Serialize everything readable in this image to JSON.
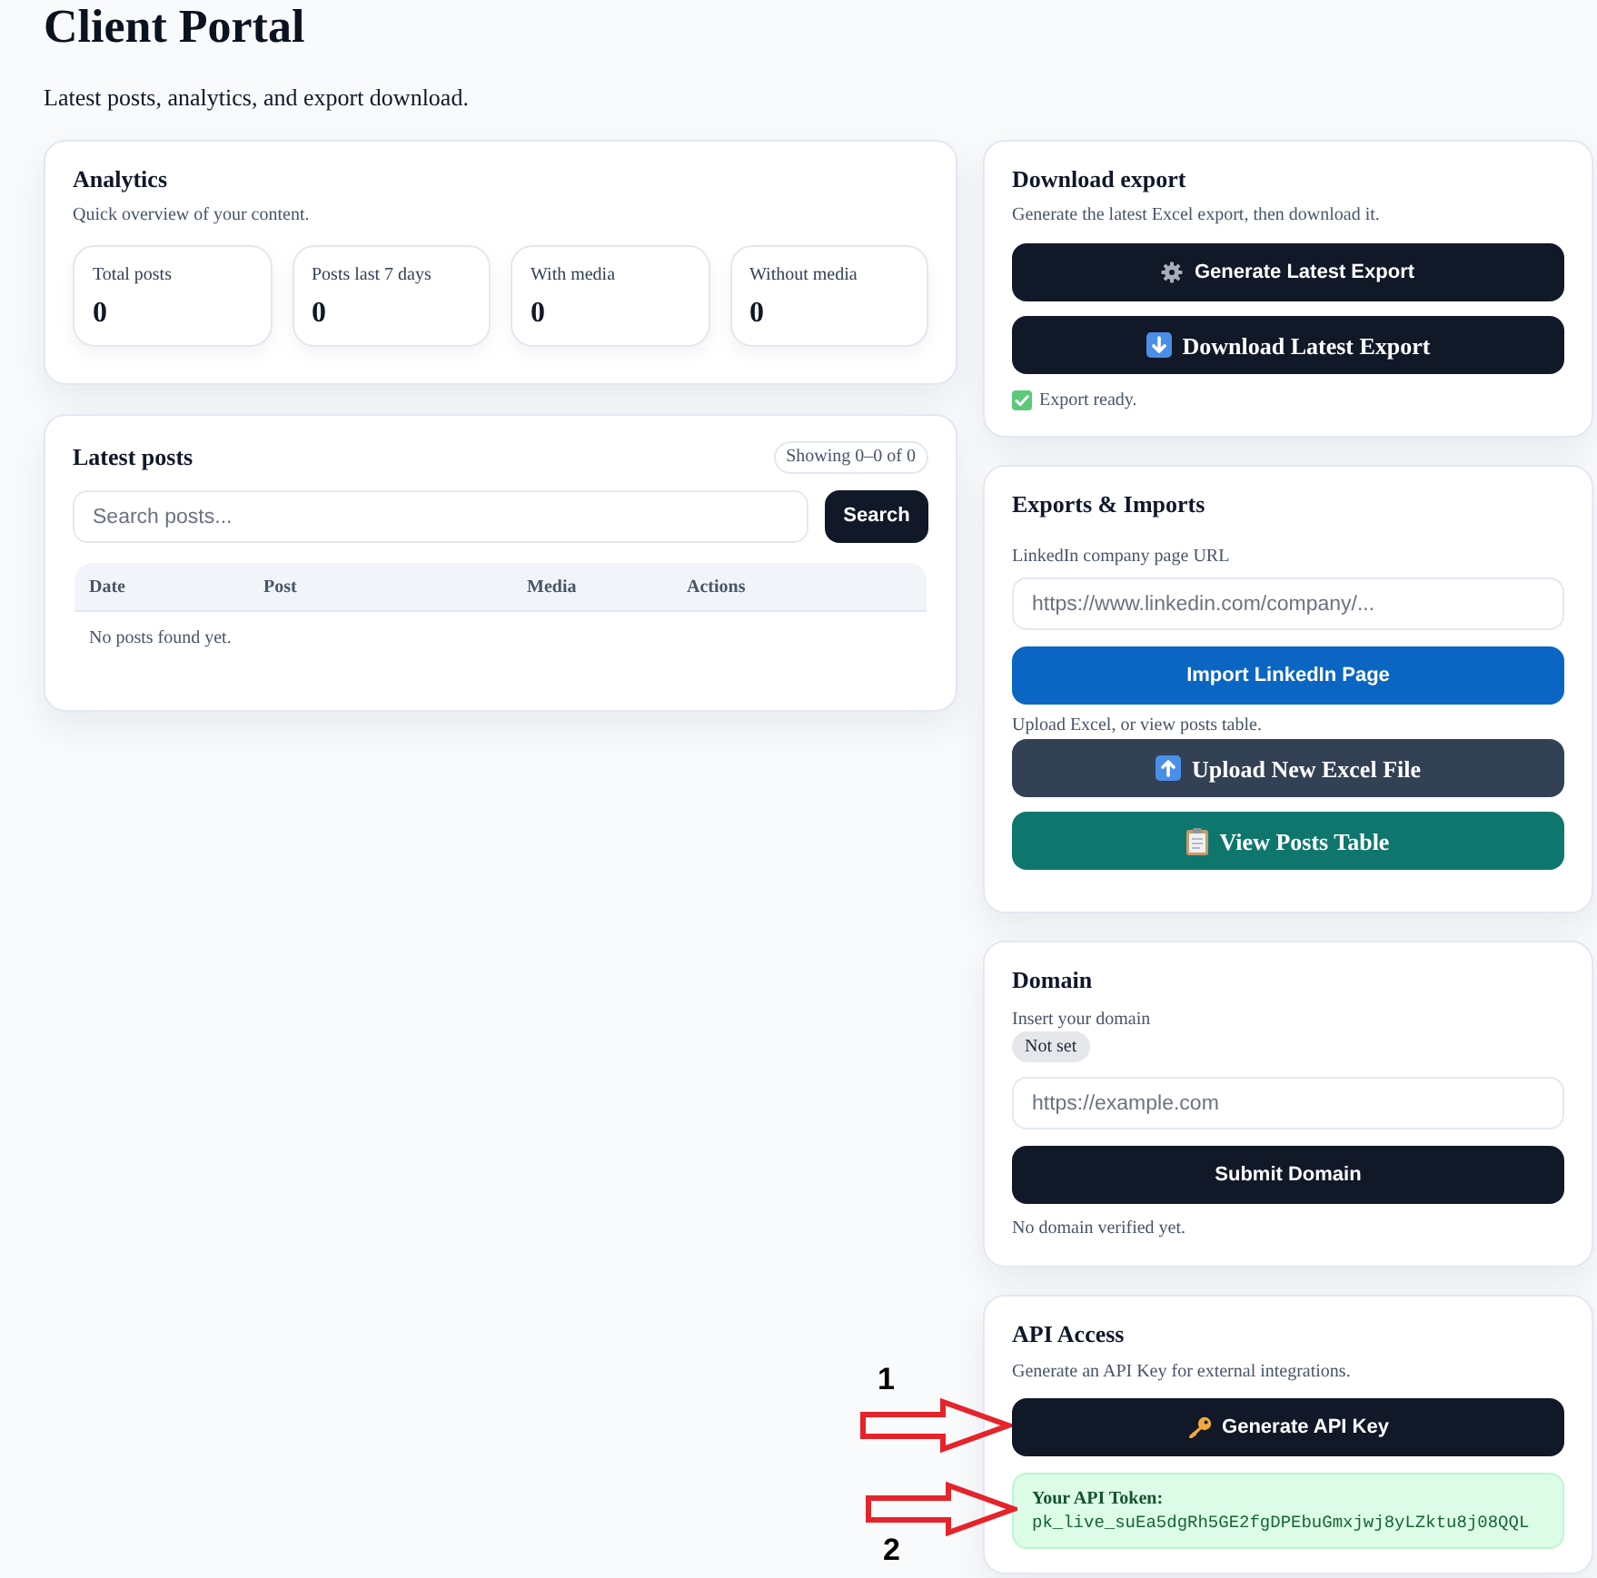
{
  "page": {
    "title": "Client Portal",
    "subtitle": "Latest posts, analytics, and export download."
  },
  "analytics": {
    "title": "Analytics",
    "subtitle": "Quick overview of your content.",
    "stats": [
      {
        "label": "Total posts",
        "value": "0"
      },
      {
        "label": "Posts last 7 days",
        "value": "0"
      },
      {
        "label": "With media",
        "value": "0"
      },
      {
        "label": "Without media",
        "value": "0"
      }
    ]
  },
  "latest_posts": {
    "title": "Latest posts",
    "badge": "Showing 0–0 of 0",
    "search": {
      "placeholder": "Search posts..."
    },
    "search_button": {
      "label": "Search",
      "kind": "search"
    },
    "table": {
      "columns": [
        "Date",
        "Post",
        "Media",
        "Actions"
      ],
      "empty_message": "No posts found yet."
    }
  },
  "download_export": {
    "title": "Download export",
    "subtitle": "Generate the latest Excel export, then download it.",
    "buttons": [
      {
        "label": "Generate Latest Export",
        "kind": "generate"
      },
      {
        "label": "Download Latest Export",
        "kind": "download"
      }
    ],
    "status": "Export ready."
  },
  "exports_imports": {
    "title": "Exports & Imports",
    "url_field": {
      "label": "LinkedIn company page URL",
      "placeholder": "https://www.linkedin.com/company/..."
    },
    "import_button": {
      "label": "Import LinkedIn Page",
      "kind": "import"
    },
    "upload_note": "Upload Excel, or view posts table.",
    "buttons": [
      {
        "label": "Upload New Excel File",
        "kind": "upload"
      },
      {
        "label": "View Posts Table",
        "kind": "view"
      }
    ]
  },
  "domain": {
    "title": "Domain",
    "subtitle": "Insert your domain",
    "status_badge": "Not set",
    "field": {
      "placeholder": "https://example.com"
    },
    "submit_button": {
      "label": "Submit Domain",
      "kind": "submit"
    },
    "note": "No domain verified yet."
  },
  "api_access": {
    "title": "API Access",
    "subtitle": "Generate an API Key for external integrations.",
    "generate_button": {
      "label": "Generate API Key",
      "kind": "api_key"
    },
    "token": {
      "label": "Your API Token:",
      "value": "pk_live_suEa5dgRh5GE2fgDPEbuGmxjwj8yLZktu8j08QQL"
    }
  },
  "annotations": [
    {
      "label": "1"
    },
    {
      "label": "2"
    }
  ]
}
